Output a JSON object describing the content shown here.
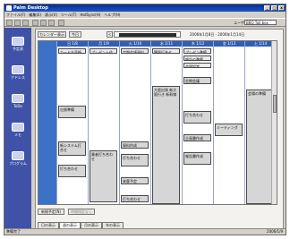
{
  "window": {
    "title": "Palm Desktop"
  },
  "menu": [
    "ファイル(F)",
    "編集(E)",
    "表示(V)",
    "ツール(T)",
    "HotSync(H)",
    "ヘルプ(H)"
  ],
  "toolbar": {
    "user_label": "ユーザ:",
    "user_value": "BBQ Tail box"
  },
  "nav": [
    "予定表",
    "アドレス",
    "ToDo",
    "メモ",
    "プログラム"
  ],
  "calendar": {
    "nav_buttons": {
      "today": "今日",
      "goto": "カレンダー表示",
      "prev": "<",
      "next": ">"
    },
    "week_label": "週 単 位",
    "range": "2006年1月8日 - 2006年1月14日",
    "days": [
      "日 1/8",
      "月 1/9",
      "火 1/10",
      "水 1/11",
      "木 1/12",
      "金 1/13",
      "土 1/14"
    ],
    "times": [
      "8",
      "9",
      "10",
      "11",
      "12",
      "13",
      "14",
      "15",
      "16",
      "17",
      "18",
      "19",
      "20",
      "21",
      "22",
      "23"
    ],
    "events": [
      {
        "day": 0,
        "label": "カードお手帳"
      },
      {
        "day": 1,
        "label": "プレゼント作成"
      },
      {
        "day": 2,
        "label": "定期会議資料"
      },
      {
        "day": 3,
        "label": "購買打合せ"
      },
      {
        "day": 4,
        "label": "プレゼン準備"
      },
      {
        "day": 4,
        "label": "報告の準備"
      },
      {
        "day": 4,
        "label": "会場設営"
      },
      {
        "day": 0,
        "label": "出張準備"
      },
      {
        "day": 0,
        "label": "新システム打合せ"
      },
      {
        "day": 0,
        "label": "打ち合わせ"
      },
      {
        "day": 1,
        "label": "業者打ち合わせ"
      },
      {
        "day": 2,
        "label": "資料作成"
      },
      {
        "day": 2,
        "label": "打ち合わせ"
      },
      {
        "day": 2,
        "label": "来客予定"
      },
      {
        "day": 2,
        "label": "打ち合わせ"
      },
      {
        "day": 3,
        "label": "大阪出張 新大阪行き 新幹線"
      },
      {
        "day": 4,
        "label": "定期会議"
      },
      {
        "day": 4,
        "label": "打ち合わせ"
      },
      {
        "day": 4,
        "label": "企画書作成"
      },
      {
        "day": 4,
        "label": "報告書作成"
      },
      {
        "day": 5,
        "label": "ミーティング"
      },
      {
        "day": 6,
        "label": "会場の準備"
      }
    ],
    "bottom": {
      "new_event": "新規予定(N)",
      "untimed": "時間指定なし"
    },
    "tabs": [
      "日の表示",
      "週の表示",
      "月の表示",
      "年の表示"
    ]
  },
  "status": {
    "left": "準備完了",
    "right": "2006/1/9"
  }
}
